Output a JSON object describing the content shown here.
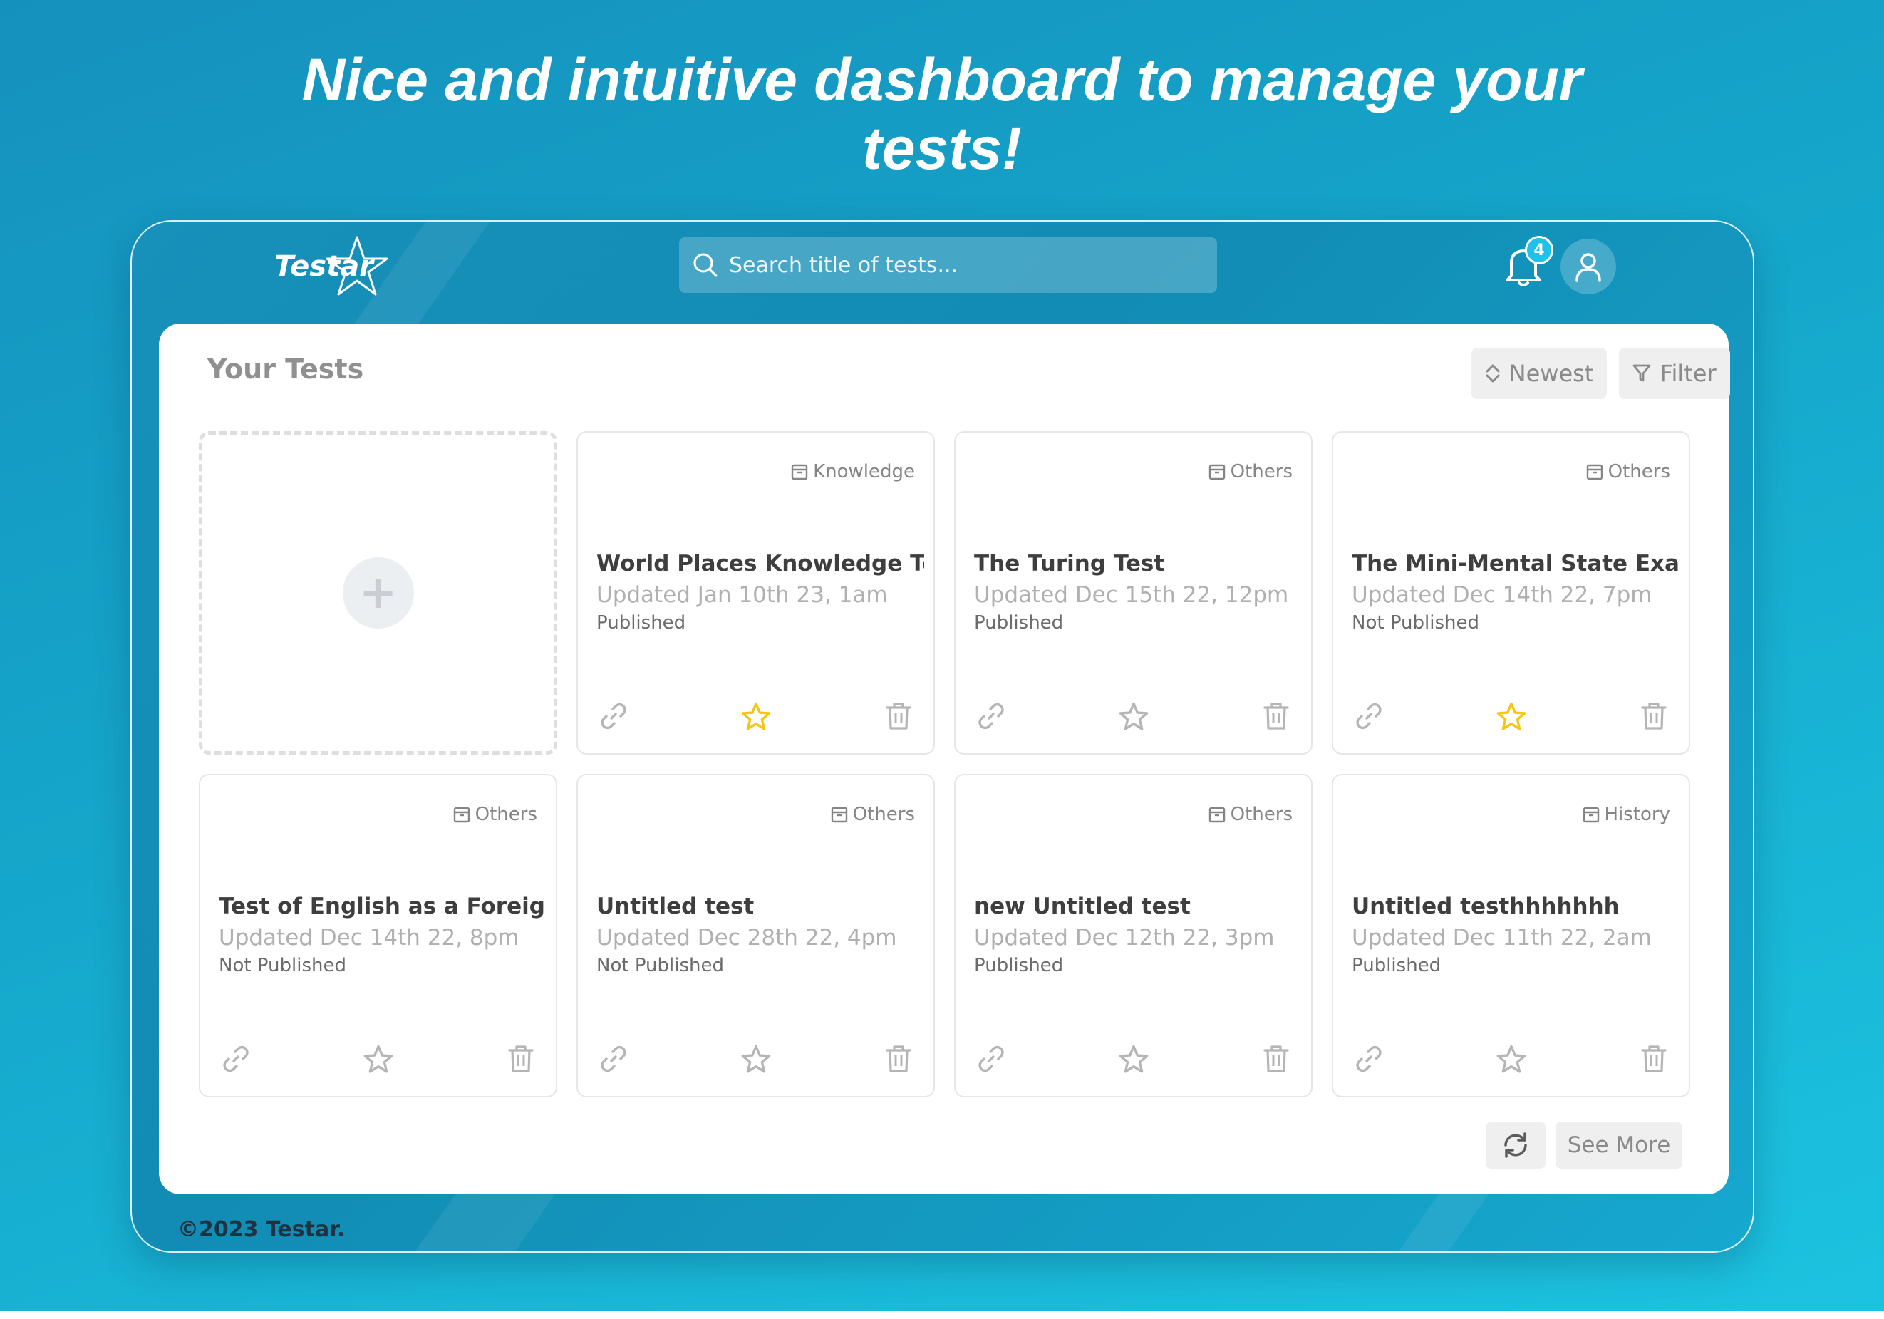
{
  "headline": "Nice and intuitive dashboard to manage your tests!",
  "header": {
    "logo_text": "Testar",
    "search_placeholder": "Search title of tests...",
    "notification_count": "4",
    "icons": [
      "search-icon",
      "bell-icon",
      "user-icon"
    ]
  },
  "panel": {
    "title": "Your Tests",
    "sort_label": "Newest",
    "filter_label": "Filter",
    "see_more_label": "See More"
  },
  "tests": [
    {
      "category": "Knowledge",
      "title": "World Places Knowledge Test",
      "updated": "Updated Jan 10th 23, 1am",
      "status": "Published",
      "starred": true
    },
    {
      "category": "Others",
      "title": "The Turing Test",
      "updated": "Updated Dec 15th 22, 12pm",
      "status": "Published",
      "starred": false
    },
    {
      "category": "Others",
      "title": "The Mini-Mental State Exami...",
      "updated": "Updated Dec 14th 22, 7pm",
      "status": "Not Published",
      "starred": true
    },
    {
      "category": "Others",
      "title": "Test of English as a Foreign ...",
      "updated": "Updated Dec 14th 22, 8pm",
      "status": "Not Published",
      "starred": false
    },
    {
      "category": "Others",
      "title": "Untitled test",
      "updated": "Updated Dec 28th 22, 4pm",
      "status": "Not Published",
      "starred": false
    },
    {
      "category": "Others",
      "title": "new Untitled test",
      "updated": "Updated Dec 12th 22, 3pm",
      "status": "Published",
      "starred": false
    },
    {
      "category": "History",
      "title": "Untitled testhhhhhhh",
      "updated": "Updated Dec 11th 22, 2am",
      "status": "Published",
      "starred": false
    }
  ],
  "colors": {
    "star_active": "#f5c518",
    "icon_muted": "#b5b5b5",
    "background_start": "#1591bd",
    "background_end": "#1cc3e0"
  },
  "footer": "©2023 Testar."
}
